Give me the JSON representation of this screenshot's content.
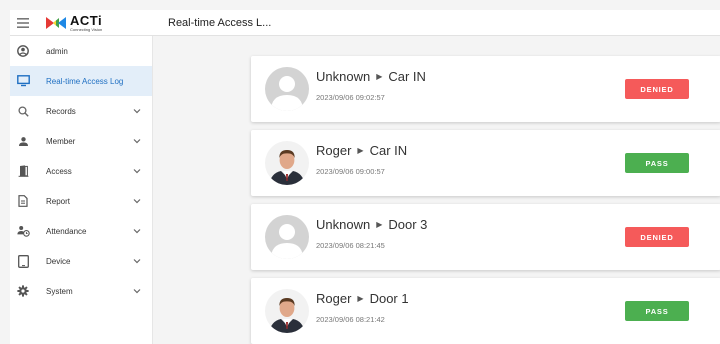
{
  "header": {
    "logo_brand": "ACTi",
    "logo_tagline": "Connecting Vision",
    "page_title": "Real-time Access L..."
  },
  "sidebar": {
    "items": [
      {
        "label": "admin",
        "icon": "account-circle-icon",
        "active": false,
        "expandable": false
      },
      {
        "label": "Real-time Access Log",
        "icon": "monitor-icon",
        "active": true,
        "expandable": false
      },
      {
        "label": "Records",
        "icon": "search-icon",
        "active": false,
        "expandable": true
      },
      {
        "label": "Member",
        "icon": "person-icon",
        "active": false,
        "expandable": true
      },
      {
        "label": "Access",
        "icon": "door-icon",
        "active": false,
        "expandable": true
      },
      {
        "label": "Report",
        "icon": "document-icon",
        "active": false,
        "expandable": true
      },
      {
        "label": "Attendance",
        "icon": "person-clock-icon",
        "active": false,
        "expandable": true
      },
      {
        "label": "Device",
        "icon": "tablet-icon",
        "active": false,
        "expandable": true
      },
      {
        "label": "System",
        "icon": "gear-icon",
        "active": false,
        "expandable": true
      }
    ]
  },
  "entries": [
    {
      "name": "Unknown",
      "location": "Car IN",
      "time": "2023/09/06 09:02:57",
      "status": "DENIED",
      "avatar": "default"
    },
    {
      "name": "Roger",
      "location": "Car IN",
      "time": "2023/09/06 09:00:57",
      "status": "PASS",
      "avatar": "photo"
    },
    {
      "name": "Unknown",
      "location": "Door 3",
      "time": "2023/09/06 08:21:45",
      "status": "DENIED",
      "avatar": "default"
    },
    {
      "name": "Roger",
      "location": "Door 1",
      "time": "2023/09/06 08:21:42",
      "status": "PASS",
      "avatar": "photo"
    }
  ],
  "colors": {
    "accent": "#1f6fc2",
    "active_bg": "#e3eef9",
    "denied": "#f55a5a",
    "pass": "#4caf50"
  }
}
